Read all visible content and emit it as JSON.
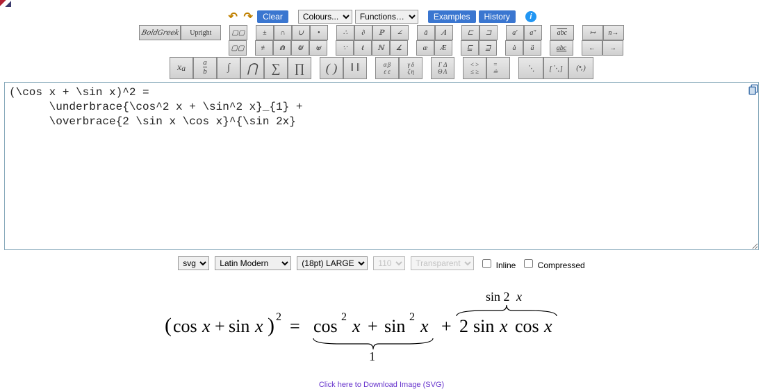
{
  "toolbar": {
    "clear": "Clear",
    "colours_placeholder": "Colours...",
    "functions_placeholder": "Functions…",
    "examples": "Examples",
    "history": "History"
  },
  "palette_row1": {
    "boldgreek": "𝐵𝑜𝑙𝑑𝐺𝑟𝑒𝑒𝑘",
    "upright": "Upright"
  },
  "editor": {
    "content": "(\\cos x + \\sin x)^2 =\n      \\underbrace{\\cos^2 x + \\sin^2 x}_{1} +\n      \\overbrace{2 \\sin x \\cos x}^{\\sin 2x}"
  },
  "options": {
    "format": "svg",
    "font": "Latin Modern",
    "size": "(18pt) LARGE",
    "dpi": "110",
    "bg": "Transparent",
    "inline_label": "Inline",
    "compressed_label": "Compressed"
  },
  "download_text": "Click here to Download Image (SVG)",
  "chart_data": {
    "type": "rendered-latex",
    "latex": "(\\cos x + \\sin x)^2 = \\underbrace{\\cos^2 x + \\sin^2 x}_{1} + \\overbrace{2\\sin x\\cos x}^{\\sin 2x}"
  }
}
